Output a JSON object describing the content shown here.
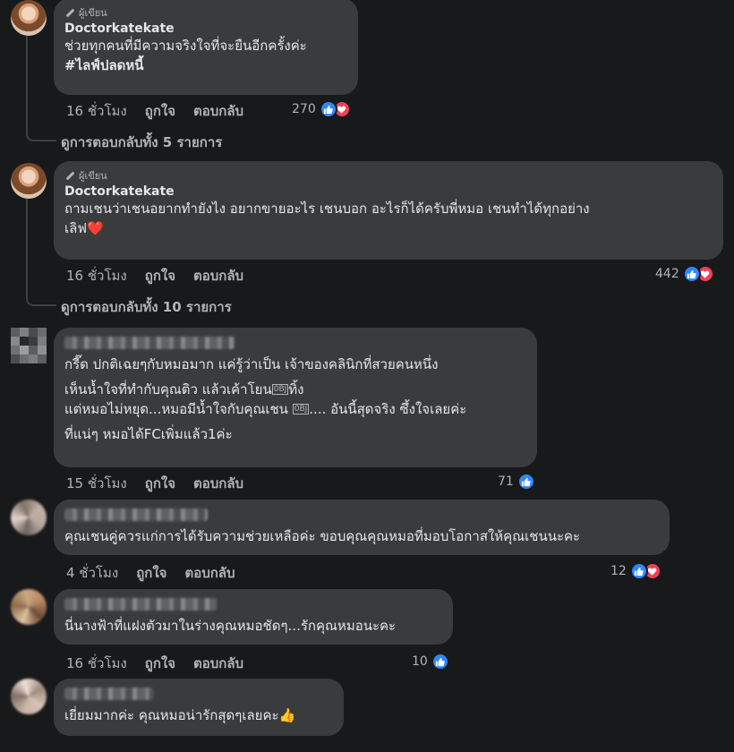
{
  "comments": [
    {
      "badge": "ผู้เขียน",
      "author": "Doctorkatekate",
      "lines": [
        "ช่วยทุกคนที่มีความจริงใจที่จะยืนอีกครั้งค่ะ",
        "#ไลฟ์ปลดหนี้"
      ],
      "time": "16 ชั่วโมง",
      "like_label": "ถูกใจ",
      "reply_label": "ตอบกลับ",
      "reaction_count": "270",
      "view_replies": "ดูการตอบกลับทั้ง 5 รายการ"
    },
    {
      "badge": "ผู้เขียน",
      "author": "Doctorkatekate",
      "lines": [
        "ถามเชนว่าเชนอยากทำยังไง อยากขายอะไร เชนบอก อะไรก็ได้ครับพี่หมอ เชนทำได้ทุกอย่าง",
        "เลิฟ"
      ],
      "heart_emoji": "❤️",
      "time": "16 ชั่วโมง",
      "like_label": "ถูกใจ",
      "reply_label": "ตอบกลับ",
      "reaction_count": "442",
      "view_replies": "ดูการตอบกลับทั้ง 10 รายการ"
    },
    {
      "lines": [
        "กรี๊ด ปกติเฉยๆกับหมอมาก แค่รู้ว่าเป็น เจ้าของคลินิกที่สวยคนหนึ่ง",
        "เห็นน้ำใจที่ทำกับคุณติว แล้วเค้าโยน",
        "ทิ้ง",
        "แต่หมอไม่หยุด...หมอมีน้ำใจกับคุณเชน",
        ".... อันนี้สุดจริง ซึ้งใจเลยค่ะ",
        "ที่แน่ๆ หมอได้FCเพิ่มแล้ว1ค่ะ"
      ],
      "inline_glyph": "0BJ",
      "time": "15 ชั่วโมง",
      "like_label": "ถูกใจ",
      "reply_label": "ตอบกลับ",
      "reaction_count": "71"
    },
    {
      "lines": [
        "คุณเชนคู่ควรแก่การได้รับความช่วยเหลือค่ะ ขอบคุณคุณหมอที่มอบโอกาสให้คุณเชนนะคะ"
      ],
      "time": "4 ชั่วโมง",
      "like_label": "ถูกใจ",
      "reply_label": "ตอบกลับ",
      "reaction_count": "12"
    },
    {
      "lines": [
        "นี่นางฟ้าที่แฝงตัวมาในร่างคุณหมอชัดๆ...รักคุณหมอนะคะ"
      ],
      "time": "16 ชั่วโมง",
      "like_label": "ถูกใจ",
      "reply_label": "ตอบกลับ",
      "reaction_count": "10"
    },
    {
      "lines": [
        "เยี่ยมมากค่ะ คุณหมอน่ารักสุดๆเลยคะ"
      ],
      "thumb_emoji": "👍"
    }
  ],
  "colors": {
    "background": "#18191a",
    "bubble": "#3a3b3c",
    "like_blue": "#2d88ff",
    "love_red": "#f33e58",
    "secondary_text": "#b0b3b8"
  }
}
